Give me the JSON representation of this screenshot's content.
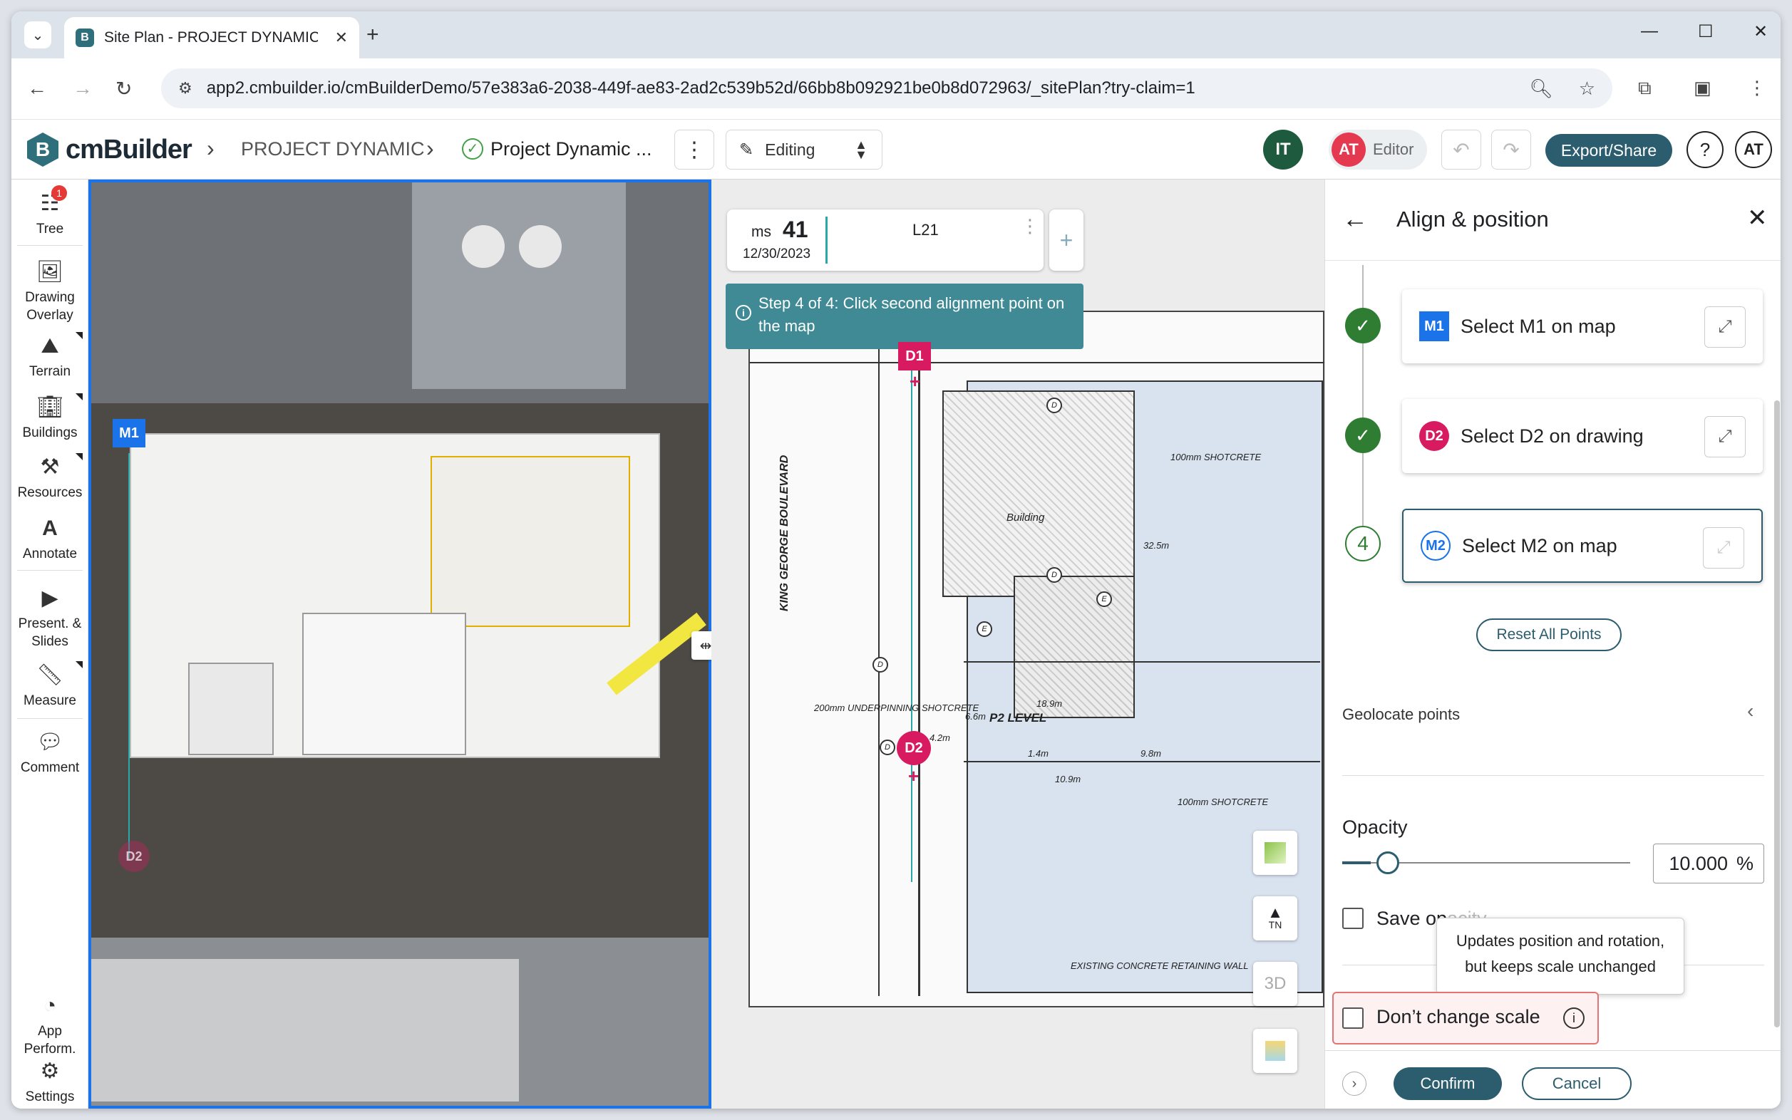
{
  "browser": {
    "tab_title": "Site Plan - PROJECT DYNAMIC |",
    "url": "app2.cmbuilder.io/cmBuilderDemo/57e383a6-2038-449f-ae83-2ad2c539b52d/66bb8b092921be0b8d072963/_sitePlan?try-claim=1"
  },
  "app": {
    "logo_text": "cmBuilder",
    "breadcrumb_project": "PROJECT DYNAMIC",
    "breadcrumb_plan": "Project Dynamic ...",
    "mode": "Editing",
    "avatar_it": "IT",
    "avatar_at": "AT",
    "role": "Editor",
    "export_label": "Export/Share",
    "help": "?",
    "user_initials": "AT"
  },
  "rail": {
    "tree": "Tree",
    "tree_badge": "1",
    "drawing_overlay_1": "Drawing",
    "drawing_overlay_2": "Overlay",
    "terrain": "Terrain",
    "buildings": "Buildings",
    "resources": "Resources",
    "annotate": "Annotate",
    "present_1": "Present. &",
    "present_2": "Slides",
    "measure": "Measure",
    "comment": "Comment",
    "app_perform_1": "App",
    "app_perform_2": "Perform.",
    "settings": "Settings"
  },
  "map": {
    "marker_m1": "M1",
    "marker_d2_ghost": "D2"
  },
  "drawing": {
    "ms_label": "ms",
    "ms_number": "41",
    "ms_date": "12/30/2023",
    "level": "L21",
    "step_banner": "Step 4 of 4: Click second alignment point on the map",
    "marker_d1": "D1",
    "marker_d2": "D2",
    "btn_tn": "TN",
    "btn_3d": "3D",
    "labels": {
      "street": "KING GEORGE BOULEVARD",
      "p2": "P2 LEVEL",
      "building": "Building",
      "shotcrete1": "200mm UNDERPINNING SHOTCRETE",
      "shotcrete2": "100mm SHOTCRETE",
      "shotcrete3": "100mm SHOTCRETE",
      "retaining": "EXISTING CONCRETE RETAINING WALL",
      "dim1": "6.6m",
      "dim2": "18.9m",
      "dim3": "1.4m",
      "dim4": "10.9m",
      "dim5": "9.8m",
      "dim6": "4.2m",
      "dim7": "32.5m"
    }
  },
  "panel": {
    "title": "Align & position",
    "step1_tag": "M1",
    "step1_label": "Select M1 on map",
    "step2_tag": "D2",
    "step2_label": "Select D2 on drawing",
    "step3_num": "4",
    "step3_tag": "M2",
    "step3_label": "Select M2 on map",
    "reset_label": "Reset All Points",
    "geolocate_label": "Geolocate points",
    "opacity_label": "Opacity",
    "opacity_value": "10.000",
    "opacity_unit": "%",
    "opacity_level": 0.1,
    "save_opacity_label": "Save op",
    "save_opacity_hidden": "acity",
    "tooltip_line1": "Updates position and rotation,",
    "tooltip_line2": "but keeps scale unchanged",
    "dont_change_scale": "Don’t change scale",
    "confirm_label": "Confirm",
    "cancel_label": "Cancel"
  },
  "colors": {
    "brand": "#2c5d6e",
    "marker_blue": "#1a73e8",
    "marker_red": "#d81b60",
    "success": "#2e7d32",
    "banner": "#3f8a94"
  }
}
